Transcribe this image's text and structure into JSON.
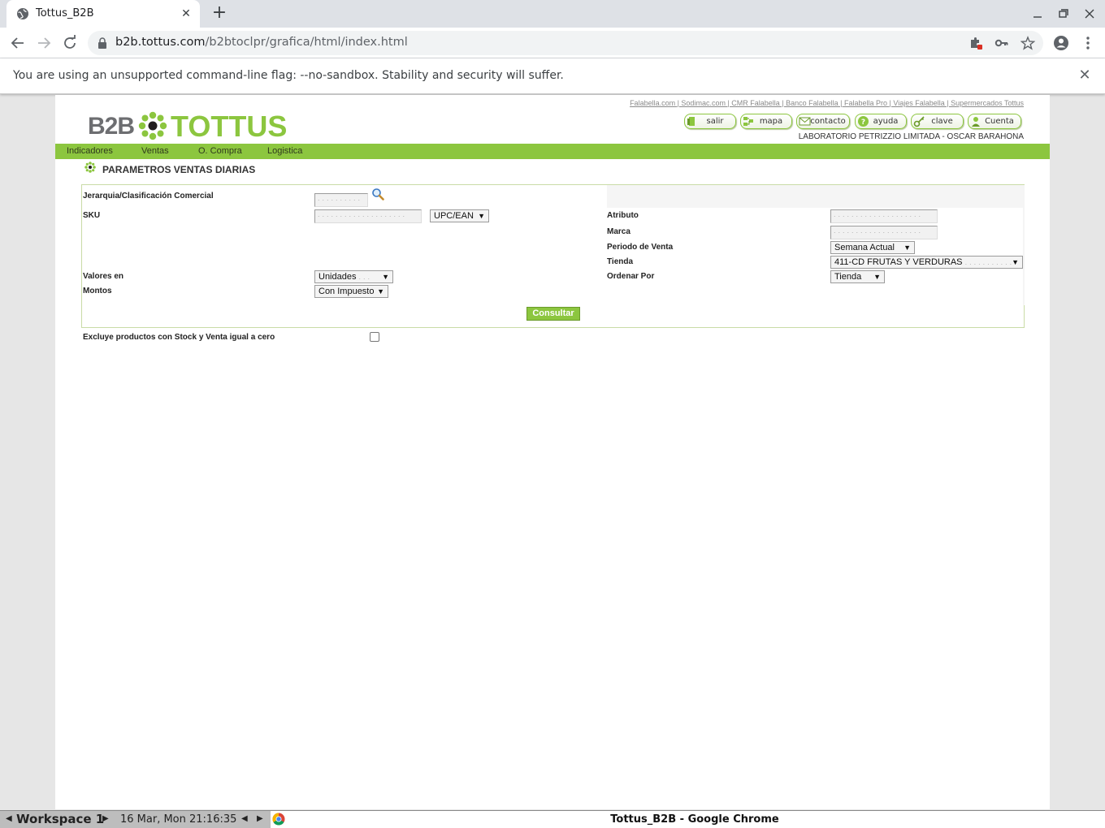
{
  "browser": {
    "tab_title": "Tottus_B2B",
    "tab_close": "✕",
    "new_tab": "+",
    "url_host": "b2b.tottus.com",
    "url_path": "/b2btoclpr/grafica/html/index.html",
    "infobar_message": "You are using an unsupported command-line flag: --no-sandbox. Stability and security will suffer.",
    "infobar_close": "✕"
  },
  "header": {
    "top_links": "Falabella.com | Sodimac.com | CMR Falabella | Banco Falabella | Falabella Pro | Viajes Falabella | Supermercados Tottus",
    "logo_b2b": "B2B",
    "logo_tottus": "TOTTUS",
    "buttons": {
      "salir": "salir",
      "mapa": "mapa",
      "contacto": "contacto",
      "ayuda": "ayuda",
      "clave": "clave",
      "cuenta": "Cuenta"
    },
    "user_line": "LABORATORIO PETRIZZIO LIMITADA - OSCAR BARAHONA"
  },
  "menu": [
    "Indicadores",
    "Ventas",
    "O. Compra",
    "Logistica"
  ],
  "section_title": "PARAMETROS VENTAS DIARIAS",
  "form": {
    "jerarquia_label": "Jerarquia/Clasificación Comercial",
    "sku_label": "SKU",
    "sku_type_value": "UPC/EAN",
    "valores_label": "Valores en",
    "valores_value": "Unidades",
    "montos_label": "Montos",
    "montos_value": "Con Impuesto",
    "atributo_label": "Atributo",
    "marca_label": "Marca",
    "periodo_label": "Periodo de Venta",
    "periodo_value": "Semana Actual",
    "tienda_label": "Tienda",
    "tienda_value": "411-CD FRUTAS Y VERDURAS",
    "ordenar_label": "Ordenar Por",
    "ordenar_value": "Tienda",
    "submit_label": "Consultar",
    "exclude_label": "Excluye productos con Stock y Venta igual a cero",
    "exclude_checked": false
  },
  "taskbar": {
    "workspace": "Workspace 1",
    "clock": "16 Mar, Mon 21:16:35",
    "window_title": "Tottus_B2B - Google Chrome"
  },
  "colors": {
    "brand_green": "#8cc63f",
    "logo_gray": "#6d6e71"
  }
}
